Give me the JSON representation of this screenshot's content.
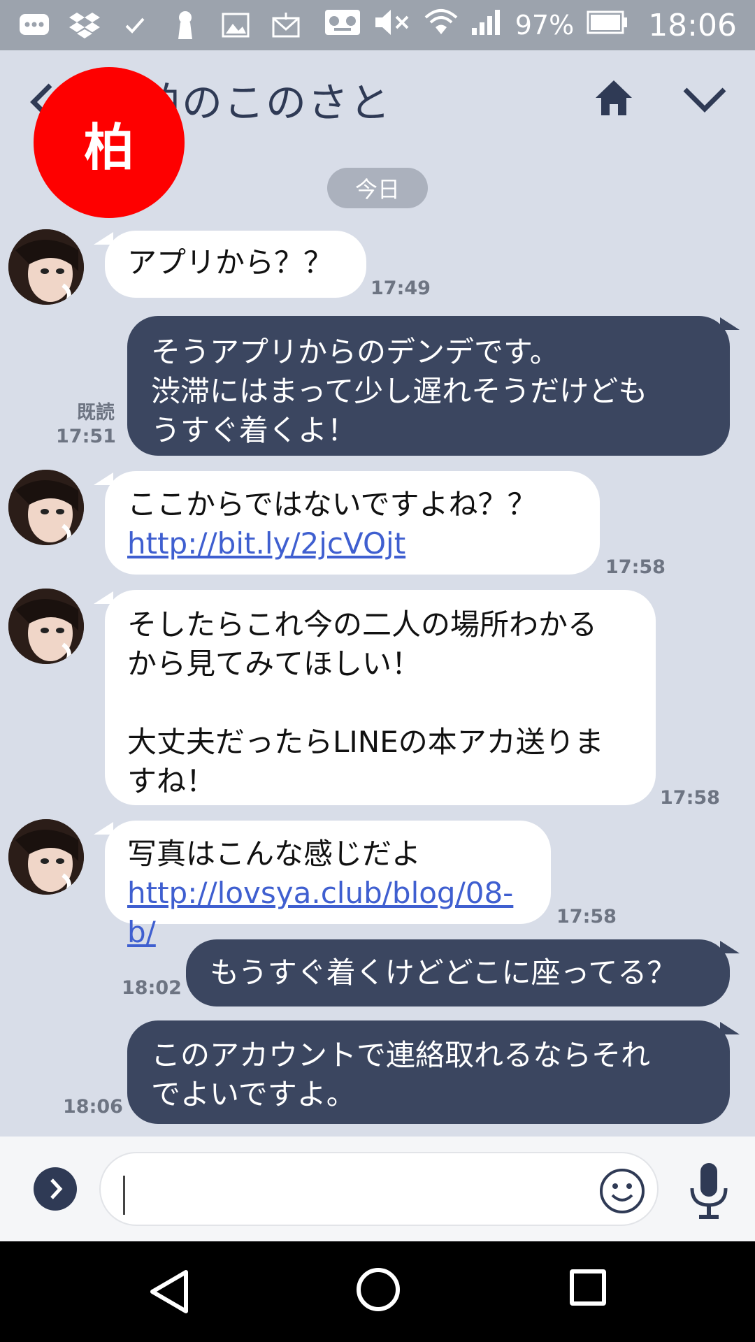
{
  "status_bar": {
    "battery": "97%",
    "time": "18:06",
    "icons": [
      "chat-bubble-icon",
      "dropbox-icon",
      "check-icon",
      "keyhole-icon",
      "image-icon",
      "mail-icon",
      "voicemail-icon",
      "mute-icon",
      "wifi-icon",
      "signal-icon",
      "battery-icon"
    ]
  },
  "header": {
    "title": "柏のこのさと",
    "badge": "柏"
  },
  "date_divider": "今日",
  "messages": [
    {
      "side": "in",
      "lines": [
        "アプリから？？"
      ],
      "time": "17:49"
    },
    {
      "side": "out",
      "lines": [
        "そうアプリからのデンデです。",
        "渋滞にはまって少し遅れそうだけども",
        "うすぐ着くよ！"
      ],
      "time": "17:51",
      "read": "既読"
    },
    {
      "side": "in",
      "lines": [
        "ここからではないですよね？？"
      ],
      "link": "http://bit.ly/2jcVOjt",
      "time": "17:58"
    },
    {
      "side": "in",
      "lines": [
        "そしたらこれ今の二人の場所わかる",
        "から見てみてほしい！",
        "",
        "大丈夫だったらLINEの本アカ送りま",
        "すね！"
      ],
      "time": "17:58"
    },
    {
      "side": "in",
      "lines": [
        "写真はこんな感じだよ"
      ],
      "link": "http://lovsya.club/blog/08-b/",
      "time": "17:58"
    },
    {
      "side": "out",
      "lines": [
        "もうすぐ着くけどどこに座ってる？"
      ],
      "time": "18:02"
    },
    {
      "side": "out",
      "lines": [
        "このアカウントで連絡取れるならそれ",
        "でよいですよ。"
      ],
      "time": "18:06"
    }
  ],
  "input": {
    "value": "",
    "placeholder": ""
  },
  "colors": {
    "background": "#d8dde8",
    "outgoing_bubble": "#3b4660",
    "incoming_bubble": "#ffffff",
    "badge": "#fe0000",
    "link": "#3f5fd0"
  }
}
